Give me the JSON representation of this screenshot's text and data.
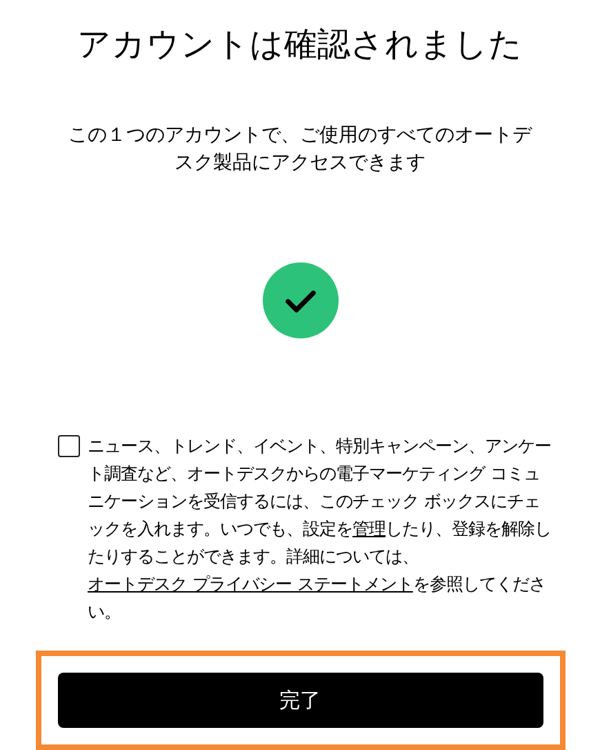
{
  "title": "アカウントは確認されました",
  "subtitle": "この１つのアカウントで、ご使用のすべてのオートデスク製品にアクセスできます",
  "consent": {
    "checked": false,
    "parts": [
      {
        "kind": "text",
        "text": "ニュース、トレンド、イベント、特別キャンペーン、アンケート調査など、オートデスクからの電子マーケティング コミュニケーションを受信するには、このチェック ボックスにチェックを入れます。いつでも、設定を"
      },
      {
        "kind": "link",
        "text": "管理"
      },
      {
        "kind": "text",
        "text": "したり、登録を解除したりすることができます。詳細については、"
      },
      {
        "kind": "link",
        "text": "オートデスク プライバシー ステートメント"
      },
      {
        "kind": "text",
        "text": "を参照してください。"
      }
    ]
  },
  "button": {
    "label": "完了",
    "highlighted": true
  }
}
